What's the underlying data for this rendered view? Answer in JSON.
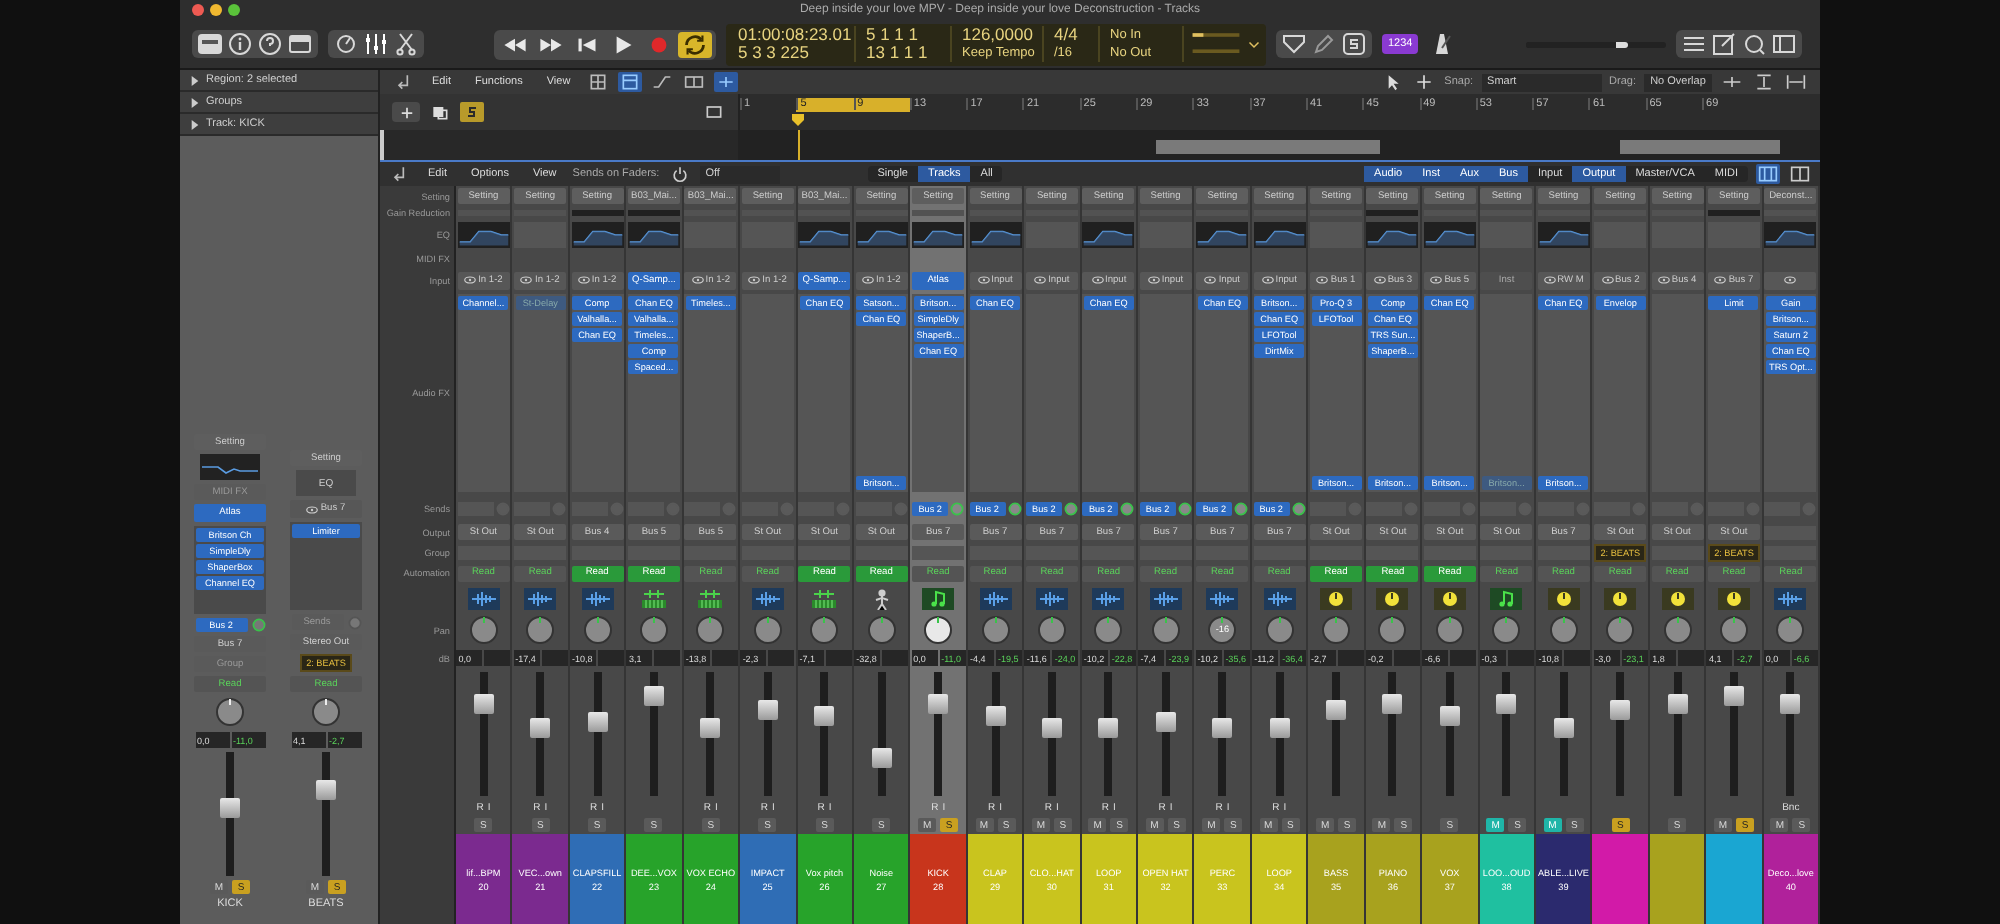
{
  "window": {
    "title": "Deep inside your love MPV - Deep inside your love Deconstruction - Tracks"
  },
  "control_bar": {
    "lcd": {
      "time": "01:00:08:23.01",
      "bars": "5  3  3  225",
      "left_locator": "5  1  1  1",
      "right_locator": "13  1  1  1",
      "tempo": "126,0000",
      "tempo_mode": "Keep Tempo",
      "signature": "4/4",
      "division": "/16",
      "midi_in": "No In",
      "midi_out": "No Out"
    },
    "cycle_on": true,
    "count_in": "1234",
    "master_volume": {
      "level": 0.72
    }
  },
  "inspector": {
    "headers": [
      {
        "label": "Region: 2 selected",
        "expanded": false
      },
      {
        "label": "Groups",
        "expanded": false
      },
      {
        "label": "Track: KICK",
        "expanded": false
      }
    ],
    "strips": [
      {
        "setting": "Setting",
        "eq": true,
        "midi_fx": "MIDI FX",
        "input": {
          "text": "Atlas",
          "kind": "plugin",
          "link": false
        },
        "audio_fx": [
          {
            "name": "Britson Ch",
            "bypassed": false
          },
          {
            "name": "SimpleDly",
            "bypassed": false
          },
          {
            "name": "ShaperBox",
            "bypassed": false
          },
          {
            "name": "Channel EQ",
            "bypassed": false
          }
        ],
        "send": "Bus 2",
        "output": "Bus 7",
        "group_label": "Group",
        "automation": "Read",
        "automation_on": false,
        "db": "0,0",
        "peak": "-11,0",
        "level": 0.55,
        "buttons": [
          {
            "label": "M",
            "kind": "mute",
            "on": false
          },
          {
            "label": "S",
            "kind": "solo",
            "on": true
          }
        ],
        "name": "KICK"
      },
      {
        "setting": "Setting",
        "eq": false,
        "eq_label": "EQ",
        "input": {
          "text": "Bus 7",
          "kind": "port",
          "link": true
        },
        "audio_fx": [
          {
            "name": "Limiter",
            "bypassed": false
          }
        ],
        "send_label": "Sends",
        "output": "Stereo Out",
        "group": "2: BEATS",
        "automation": "Read",
        "automation_on": false,
        "db": "4,1",
        "peak": "-2,7",
        "level": 0.7,
        "buttons": [
          {
            "label": "M",
            "kind": "mute",
            "on": false
          },
          {
            "label": "S",
            "kind": "solo",
            "on": true
          }
        ],
        "name": "BEATS"
      }
    ]
  },
  "tracks": {
    "menus": [
      "Edit",
      "Functions",
      "View"
    ],
    "snap_label": "Snap:",
    "snap": "Smart",
    "drag_label": "Drag:",
    "drag": "No Overlap",
    "ruler": [
      "1",
      "5",
      "9",
      "13",
      "17",
      "21",
      "25",
      "29",
      "33",
      "37",
      "41",
      "45",
      "49",
      "53",
      "57",
      "61",
      "65",
      "69"
    ]
  },
  "mixer": {
    "menus": [
      "Edit",
      "Options",
      "View"
    ],
    "sends_label": "Sends on Faders:",
    "sends_value": "Off",
    "views": [
      {
        "label": "Single",
        "selected": false
      },
      {
        "label": "Tracks",
        "selected": true
      },
      {
        "label": "All",
        "selected": false
      }
    ],
    "filters": [
      {
        "label": "Audio",
        "on": true
      },
      {
        "label": "Inst",
        "on": true
      },
      {
        "label": "Aux",
        "on": true
      },
      {
        "label": "Bus",
        "on": true
      },
      {
        "label": "Input",
        "on": false
      },
      {
        "label": "Output",
        "on": true
      },
      {
        "label": "Master/VCA",
        "on": false
      },
      {
        "label": "MIDI",
        "on": false
      }
    ],
    "row_labels": [
      "Setting",
      "Gain Reduction",
      "EQ",
      "MIDI FX",
      "Input",
      "Audio FX",
      "Sends",
      "Output",
      "Group",
      "Automation",
      "Pan",
      "dB"
    ],
    "strips": [
      {
        "selected": false,
        "setting": "Setting",
        "gain_meter": false,
        "eq": true,
        "input": {
          "text": "In 1-2",
          "kind": "port",
          "link": true
        },
        "audio_fx": [
          {
            "name": "Channel...",
            "bypassed": false
          }
        ],
        "output": "St Out",
        "automation": "Read",
        "automation_on": false,
        "kind": "audio",
        "db": "0,0",
        "level": 0.75,
        "rec": [
          "R",
          "I"
        ],
        "buttons": [
          {
            "label": "S",
            "kind": "solo",
            "on": false
          }
        ],
        "name": "lif...BPM",
        "number": "20",
        "color": "#7b2a8f"
      },
      {
        "selected": false,
        "setting": "Setting",
        "gain_meter": false,
        "eq": false,
        "input": {
          "text": "In 1-2",
          "kind": "port",
          "link": true
        },
        "audio_fx": [
          {
            "name": "St-Delay",
            "bypassed": true
          }
        ],
        "output": "St Out",
        "automation": "Read",
        "automation_on": false,
        "kind": "audio",
        "db": "-17,4",
        "level": 0.55,
        "rec": [
          "R",
          "I"
        ],
        "buttons": [
          {
            "label": "S",
            "kind": "solo",
            "on": false
          }
        ],
        "name": "VEC...own",
        "number": "21",
        "color": "#7b2a8f"
      },
      {
        "selected": false,
        "setting": "Setting",
        "gain_meter": true,
        "eq": true,
        "input": {
          "text": "In 1-2",
          "kind": "port",
          "link": true
        },
        "audio_fx": [
          {
            "name": "Comp",
            "bypassed": false
          },
          {
            "name": "Valhalla...",
            "bypassed": false
          },
          {
            "name": "Chan EQ",
            "bypassed": false
          }
        ],
        "output": "Bus 4",
        "automation": "Read",
        "automation_on": true,
        "kind": "audio",
        "db": "-10,8",
        "level": 0.6,
        "rec": [
          "R",
          "I"
        ],
        "buttons": [
          {
            "label": "S",
            "kind": "solo",
            "on": false
          }
        ],
        "name": "CLAPSFILL",
        "number": "22",
        "color": "#2f6db5"
      },
      {
        "selected": false,
        "setting": "B03_Mai...",
        "gain_meter": true,
        "eq": true,
        "input": {
          "text": "Q-Samp...",
          "kind": "plugin",
          "link": false
        },
        "audio_fx": [
          {
            "name": "Chan EQ",
            "bypassed": false
          },
          {
            "name": "Valhalla...",
            "bypassed": false
          },
          {
            "name": "Timeles...",
            "bypassed": false
          },
          {
            "name": "Comp",
            "bypassed": false
          },
          {
            "name": "Spaced...",
            "bypassed": false
          }
        ],
        "output": "Bus 5",
        "automation": "Read",
        "automation_on": true,
        "kind": "drum",
        "db": "3,1",
        "level": 0.8,
        "buttons": [
          {
            "label": "S",
            "kind": "solo",
            "on": false
          }
        ],
        "name": "DEE...VOX",
        "number": "23",
        "color": "#27a32a"
      },
      {
        "selected": false,
        "setting": "B03_Mai...",
        "gain_meter": false,
        "eq": false,
        "input": {
          "text": "In 1-2",
          "kind": "port",
          "link": true
        },
        "audio_fx": [
          {
            "name": "Timeles...",
            "bypassed": false
          }
        ],
        "output": "Bus 5",
        "automation": "Read",
        "automation_on": false,
        "kind": "drum",
        "db": "-13,8",
        "level": 0.55,
        "rec": [
          "R",
          "I"
        ],
        "buttons": [
          {
            "label": "S",
            "kind": "solo",
            "on": false
          }
        ],
        "name": "VOX ECHO",
        "number": "24",
        "color": "#27a32a"
      },
      {
        "selected": false,
        "setting": "Setting",
        "gain_meter": false,
        "eq": false,
        "input": {
          "text": "In 1-2",
          "kind": "port",
          "link": true
        },
        "output": "St Out",
        "automation": "Read",
        "automation_on": false,
        "kind": "audio",
        "db": "-2,3",
        "level": 0.7,
        "rec": [
          "R",
          "I"
        ],
        "buttons": [
          {
            "label": "S",
            "kind": "solo",
            "on": false
          }
        ],
        "name": "IMPACT",
        "number": "25",
        "color": "#2f6db5"
      },
      {
        "selected": false,
        "setting": "B03_Mai...",
        "gain_meter": false,
        "eq": true,
        "input": {
          "text": "Q-Samp...",
          "kind": "plugin",
          "link": false
        },
        "audio_fx": [
          {
            "name": "Chan EQ",
            "bypassed": false
          }
        ],
        "output": "St Out",
        "automation": "Read",
        "automation_on": true,
        "kind": "drum",
        "db": "-7,1",
        "level": 0.65,
        "rec": [
          "R",
          "I"
        ],
        "buttons": [
          {
            "label": "S",
            "kind": "solo",
            "on": false
          }
        ],
        "name": "Vox pitch",
        "number": "26",
        "color": "#27a32a"
      },
      {
        "selected": false,
        "setting": "Setting",
        "gain_meter": false,
        "eq": true,
        "input": {
          "text": "In 1-2",
          "kind": "port",
          "link": true
        },
        "audio_fx": [
          {
            "name": "Satson...",
            "bypassed": false
          },
          {
            "name": "Chan EQ",
            "bypassed": false
          }
        ],
        "post_fx": [
          {
            "name": "Britson...",
            "bypassed": false
          }
        ],
        "output": "St Out",
        "automation": "Read",
        "automation_on": true,
        "kind": "drummer",
        "db": "-32,8",
        "level": 0.3,
        "buttons": [
          {
            "label": "S",
            "kind": "solo",
            "on": false
          }
        ],
        "name": "Noise",
        "number": "27",
        "color": "#27a32a"
      },
      {
        "selected": true,
        "setting": "Setting",
        "gain_meter": false,
        "eq": true,
        "input": {
          "text": "Atlas",
          "kind": "plugin",
          "link": false
        },
        "audio_fx": [
          {
            "name": "Britson...",
            "bypassed": false
          },
          {
            "name": "SimpleDly",
            "bypassed": false
          },
          {
            "name": "ShaperB...",
            "bypassed": false
          },
          {
            "name": "Chan EQ",
            "bypassed": false
          }
        ],
        "send": "Bus 2",
        "output": "Bus 7",
        "automation": "Read",
        "automation_on": false,
        "kind": "midi",
        "db": "0,0",
        "peak": "-11,0",
        "level": 0.75,
        "rec": [
          "R",
          "I"
        ],
        "buttons": [
          {
            "label": "M",
            "kind": "mute",
            "on": false
          },
          {
            "label": "S",
            "kind": "solo",
            "on": true
          }
        ],
        "name": "KICK",
        "number": "28",
        "color": "#c8351c"
      },
      {
        "selected": false,
        "setting": "Setting",
        "gain_meter": false,
        "eq": true,
        "input": {
          "text": "Input",
          "kind": "port",
          "link": true
        },
        "audio_fx": [
          {
            "name": "Chan EQ",
            "bypassed": false
          }
        ],
        "send": "Bus 2",
        "output": "Bus 7",
        "automation": "Read",
        "automation_on": false,
        "kind": "audio",
        "db": "-4,4",
        "peak": "-19,5",
        "level": 0.65,
        "rec": [
          "R",
          "I"
        ],
        "buttons": [
          {
            "label": "M",
            "kind": "mute",
            "on": false
          },
          {
            "label": "S",
            "kind": "solo",
            "on": false
          }
        ],
        "name": "CLAP",
        "number": "29",
        "color": "#c9c41e"
      },
      {
        "selected": false,
        "setting": "Setting",
        "gain_meter": false,
        "eq": false,
        "input": {
          "text": "Input",
          "kind": "port",
          "link": true
        },
        "send": "Bus 2",
        "output": "Bus 7",
        "automation": "Read",
        "automation_on": false,
        "kind": "audio",
        "db": "-11,6",
        "peak": "-24,0",
        "level": 0.55,
        "rec": [
          "R",
          "I"
        ],
        "buttons": [
          {
            "label": "M",
            "kind": "mute",
            "on": false
          },
          {
            "label": "S",
            "kind": "solo",
            "on": false
          }
        ],
        "name": "CLO...HAT",
        "number": "30",
        "color": "#c9c41e"
      },
      {
        "selected": false,
        "setting": "Setting",
        "gain_meter": false,
        "eq": true,
        "input": {
          "text": "Input",
          "kind": "port",
          "link": true
        },
        "audio_fx": [
          {
            "name": "Chan EQ",
            "bypassed": false
          }
        ],
        "send": "Bus 2",
        "output": "Bus 7",
        "automation": "Read",
        "automation_on": false,
        "kind": "audio",
        "db": "-10,2",
        "peak": "-22,8",
        "level": 0.55,
        "rec": [
          "R",
          "I"
        ],
        "buttons": [
          {
            "label": "M",
            "kind": "mute",
            "on": false
          },
          {
            "label": "S",
            "kind": "solo",
            "on": false
          }
        ],
        "name": "LOOP",
        "number": "31",
        "color": "#c9c41e"
      },
      {
        "selected": false,
        "setting": "Setting",
        "gain_meter": false,
        "eq": false,
        "input": {
          "text": "Input",
          "kind": "port",
          "link": true
        },
        "send": "Bus 2",
        "output": "Bus 7",
        "automation": "Read",
        "automation_on": false,
        "kind": "audio",
        "db": "-7,4",
        "peak": "-23,9",
        "level": 0.6,
        "rec": [
          "R",
          "I"
        ],
        "buttons": [
          {
            "label": "M",
            "kind": "mute",
            "on": false
          },
          {
            "label": "S",
            "kind": "solo",
            "on": false
          }
        ],
        "name": "OPEN HAT",
        "number": "32",
        "color": "#c9c41e"
      },
      {
        "selected": false,
        "setting": "Setting",
        "gain_meter": false,
        "eq": true,
        "input": {
          "text": "Input",
          "kind": "port",
          "link": true
        },
        "audio_fx": [
          {
            "name": "Chan EQ",
            "bypassed": false
          }
        ],
        "send": "Bus 2",
        "output": "Bus 7",
        "automation": "Read",
        "automation_on": false,
        "kind": "audio",
        "pan_label": "-16",
        "db": "-10,2",
        "peak": "-35,6",
        "level": 0.55,
        "rec": [
          "R",
          "I"
        ],
        "buttons": [
          {
            "label": "M",
            "kind": "mute",
            "on": false
          },
          {
            "label": "S",
            "kind": "solo",
            "on": false
          }
        ],
        "name": "PERC",
        "number": "33",
        "color": "#c9c41e"
      },
      {
        "selected": false,
        "setting": "Setting",
        "gain_meter": false,
        "eq": true,
        "input": {
          "text": "Input",
          "kind": "port",
          "link": true
        },
        "audio_fx": [
          {
            "name": "Britson...",
            "bypassed": false
          },
          {
            "name": "Chan EQ",
            "bypassed": false
          },
          {
            "name": "LFOTool",
            "bypassed": false
          },
          {
            "name": "DirtMix",
            "bypassed": false
          }
        ],
        "send": "Bus 2",
        "output": "Bus 7",
        "automation": "Read",
        "automation_on": false,
        "kind": "audio",
        "db": "-11,2",
        "peak": "-36,4",
        "level": 0.55,
        "rec": [
          "R",
          "I"
        ],
        "buttons": [
          {
            "label": "M",
            "kind": "mute",
            "on": false
          },
          {
            "label": "S",
            "kind": "solo",
            "on": false
          }
        ],
        "name": "LOOP",
        "number": "34",
        "color": "#c9c41e"
      },
      {
        "selected": false,
        "setting": "Setting",
        "gain_meter": false,
        "eq": false,
        "input": {
          "text": "Bus 1",
          "kind": "port",
          "link": true
        },
        "audio_fx": [
          {
            "name": "Pro-Q 3",
            "bypassed": false
          },
          {
            "name": "LFOTool",
            "bypassed": false
          }
        ],
        "post_fx": [
          {
            "name": "Britson...",
            "bypassed": false
          }
        ],
        "output": "St Out",
        "automation": "Read",
        "automation_on": true,
        "kind": "aux",
        "db": "-2,7",
        "level": 0.7,
        "buttons": [
          {
            "label": "M",
            "kind": "mute",
            "on": false
          },
          {
            "label": "S",
            "kind": "solo",
            "on": false
          }
        ],
        "name": "BASS",
        "number": "35",
        "color": "#a8a21e"
      },
      {
        "selected": false,
        "setting": "Setting",
        "gain_meter": true,
        "eq": true,
        "input": {
          "text": "Bus 3",
          "kind": "port",
          "link": true
        },
        "audio_fx": [
          {
            "name": "Comp",
            "bypassed": false
          },
          {
            "name": "Chan EQ",
            "bypassed": false
          },
          {
            "name": "TRS Sun...",
            "bypassed": false
          },
          {
            "name": "ShaperB...",
            "bypassed": false
          }
        ],
        "post_fx": [
          {
            "name": "Britson...",
            "bypassed": false
          }
        ],
        "output": "St Out",
        "automation": "Read",
        "automation_on": true,
        "kind": "aux",
        "db": "-0,2",
        "level": 0.75,
        "buttons": [
          {
            "label": "M",
            "kind": "mute",
            "on": false
          },
          {
            "label": "S",
            "kind": "solo",
            "on": false
          }
        ],
        "name": "PIANO",
        "number": "36",
        "color": "#a8a21e"
      },
      {
        "selected": false,
        "setting": "Setting",
        "gain_meter": false,
        "eq": true,
        "input": {
          "text": "Bus 5",
          "kind": "port",
          "link": true
        },
        "audio_fx": [
          {
            "name": "Chan EQ",
            "bypassed": false
          }
        ],
        "post_fx": [
          {
            "name": "Britson...",
            "bypassed": false
          }
        ],
        "output": "St Out",
        "automation": "Read",
        "automation_on": true,
        "kind": "aux",
        "db": "-6,6",
        "level": 0.65,
        "buttons": [
          {
            "label": "S",
            "kind": "solo",
            "on": false
          }
        ],
        "name": "VOX",
        "number": "37",
        "color": "#a8a21e"
      },
      {
        "selected": false,
        "setting": "Setting",
        "gain_meter": false,
        "eq": false,
        "input": {
          "text": "Inst",
          "kind": "inst",
          "link": false
        },
        "post_fx": [
          {
            "name": "Britson...",
            "bypassed": true
          }
        ],
        "output": "St Out",
        "automation": "Read",
        "automation_on": false,
        "kind": "midi",
        "db": "-0,3",
        "level": 0.75,
        "buttons": [
          {
            "label": "M",
            "kind": "mute",
            "on": true
          },
          {
            "label": "S",
            "kind": "solo",
            "on": false
          }
        ],
        "name": "LOO...OUD",
        "number": "38",
        "color": "#1fc0a0"
      },
      {
        "selected": false,
        "setting": "Setting",
        "gain_meter": false,
        "eq": true,
        "input": {
          "text": "RW M",
          "kind": "port",
          "link": true
        },
        "audio_fx": [
          {
            "name": "Chan EQ",
            "bypassed": false
          }
        ],
        "post_fx": [
          {
            "name": "Britson...",
            "bypassed": false
          }
        ],
        "output": "Bus 7",
        "automation": "Read",
        "automation_on": false,
        "kind": "aux",
        "db": "-10,8",
        "level": 0.55,
        "buttons": [
          {
            "label": "M",
            "kind": "mute",
            "on": true
          },
          {
            "label": "S",
            "kind": "solo",
            "on": false
          }
        ],
        "name": "ABLE...LIVE",
        "number": "39",
        "color": "#2b2a6e"
      },
      {
        "selected": false,
        "setting": "Setting",
        "gain_meter": false,
        "eq": false,
        "input": {
          "text": "Bus 2",
          "kind": "port",
          "link": true
        },
        "audio_fx": [
          {
            "name": "Envelop",
            "bypassed": false
          }
        ],
        "output": "St Out",
        "group": "2: BEATS",
        "automation": "Read",
        "automation_on": false,
        "kind": "aux",
        "db": "-3,0",
        "peak": "-23,1",
        "level": 0.7,
        "buttons": [
          {
            "label": "S",
            "kind": "solo",
            "on": true
          }
        ],
        "color": "#d21aa8"
      },
      {
        "selected": false,
        "setting": "Setting",
        "gain_meter": false,
        "eq": false,
        "input": {
          "text": "Bus 4",
          "kind": "port",
          "link": true
        },
        "output": "St Out",
        "automation": "Read",
        "automation_on": false,
        "kind": "aux",
        "db": "1,8",
        "level": 0.75,
        "buttons": [
          {
            "label": "S",
            "kind": "solo",
            "on": false
          }
        ],
        "color": "#a8a21e"
      },
      {
        "selected": false,
        "setting": "Setting",
        "gain_meter": true,
        "eq": false,
        "input": {
          "text": "Bus 7",
          "kind": "port",
          "link": true
        },
        "audio_fx": [
          {
            "name": "Limit",
            "bypassed": false
          }
        ],
        "output": "St Out",
        "group": "2: BEATS",
        "automation": "Read",
        "automation_on": false,
        "kind": "aux",
        "db": "4,1",
        "peak": "-2,7",
        "level": 0.8,
        "buttons": [
          {
            "label": "M",
            "kind": "mute",
            "on": false
          },
          {
            "label": "S",
            "kind": "solo",
            "on": true
          }
        ],
        "color": "#1aa6d2"
      },
      {
        "selected": false,
        "setting": "Deconst...",
        "gain_meter": false,
        "eq": true,
        "input": {
          "kind": "port",
          "link": true
        },
        "audio_fx": [
          {
            "name": "Gain",
            "bypassed": false
          },
          {
            "name": "Britson...",
            "bypassed": false
          },
          {
            "name": "Saturn 2",
            "bypassed": false
          },
          {
            "name": "Chan EQ",
            "bypassed": false
          },
          {
            "name": "TRS Opt...",
            "bypassed": false
          }
        ],
        "automation": "Read",
        "automation_on": false,
        "kind": "audio",
        "db": "0,0",
        "peak": "-6,6",
        "level": 0.75,
        "bounce": "Bnc",
        "buttons": [
          {
            "label": "M",
            "kind": "mute",
            "on": false
          },
          {
            "label": "S",
            "kind": "solo",
            "on": false
          }
        ],
        "name": "Deco...love",
        "number": "40",
        "color": "#b0219b"
      }
    ]
  }
}
